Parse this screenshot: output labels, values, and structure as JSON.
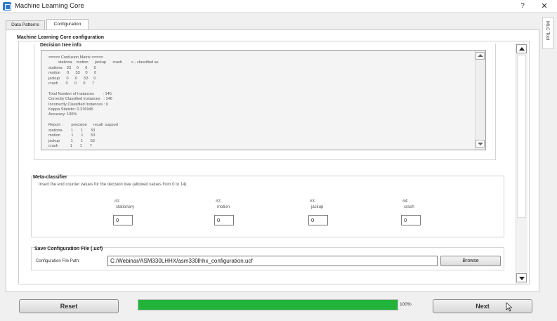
{
  "window": {
    "title": "Machine Learning Core",
    "help_glyph": "?",
    "close_glyph": "✕",
    "side_tab_label": "MLC Tool"
  },
  "tabs": [
    {
      "label": "Data Patterns",
      "active": false
    },
    {
      "label": "Configuration",
      "active": true
    }
  ],
  "main": {
    "section_title": "Machine Learning Core configuration"
  },
  "decision_tree": {
    "title": "Decision tree info",
    "lines": [
      "===== Confusion Matrix =====",
      "         stationa    motion      jackup      crash        <-- classified as",
      "stationa    33     0      0      0",
      "motion      0      53     0      0",
      "jackup      0      0      53     0",
      "crash       0      0      0      7",
      "",
      "Total Number of Instances        : 146",
      "Correctly Classified Instances   : 146",
      "Incorrectly Classified Instances : 0",
      "Kappa Statistic: 0.316945",
      "Accuracy: 100%",
      "",
      "Report  :       precision      recall  support",
      "stationa        1       1       33",
      "motion          1       1       53",
      "jackup          1       1       53",
      "crash           1       1       7"
    ]
  },
  "meta_classifier": {
    "title": "Meta-classifier",
    "description": "Insert the end counter values for the decision tree (allowed values from 0 to 14):",
    "classes": [
      {
        "number": "#1:",
        "name": "stationary",
        "value": "0"
      },
      {
        "number": "#2:",
        "name": "motion",
        "value": "0"
      },
      {
        "number": "#3:",
        "name": "jackup",
        "value": "0"
      },
      {
        "number": "#4:",
        "name": "crash",
        "value": "0"
      }
    ]
  },
  "save_config": {
    "title": "Save Configuration File (.ucf)",
    "path_label": "Configuration File Path:",
    "path_value": "C:/Webinar/ASM330LHHX/asm330lhhx_configuration.ucf",
    "browse_label": "Browse"
  },
  "footer": {
    "reset_label": "Reset",
    "next_label": "Next",
    "progress_value": 100,
    "progress_label": "100%"
  },
  "colors": {
    "progress_fill": "#22b33a",
    "app_icon": "#2e7bcf"
  }
}
